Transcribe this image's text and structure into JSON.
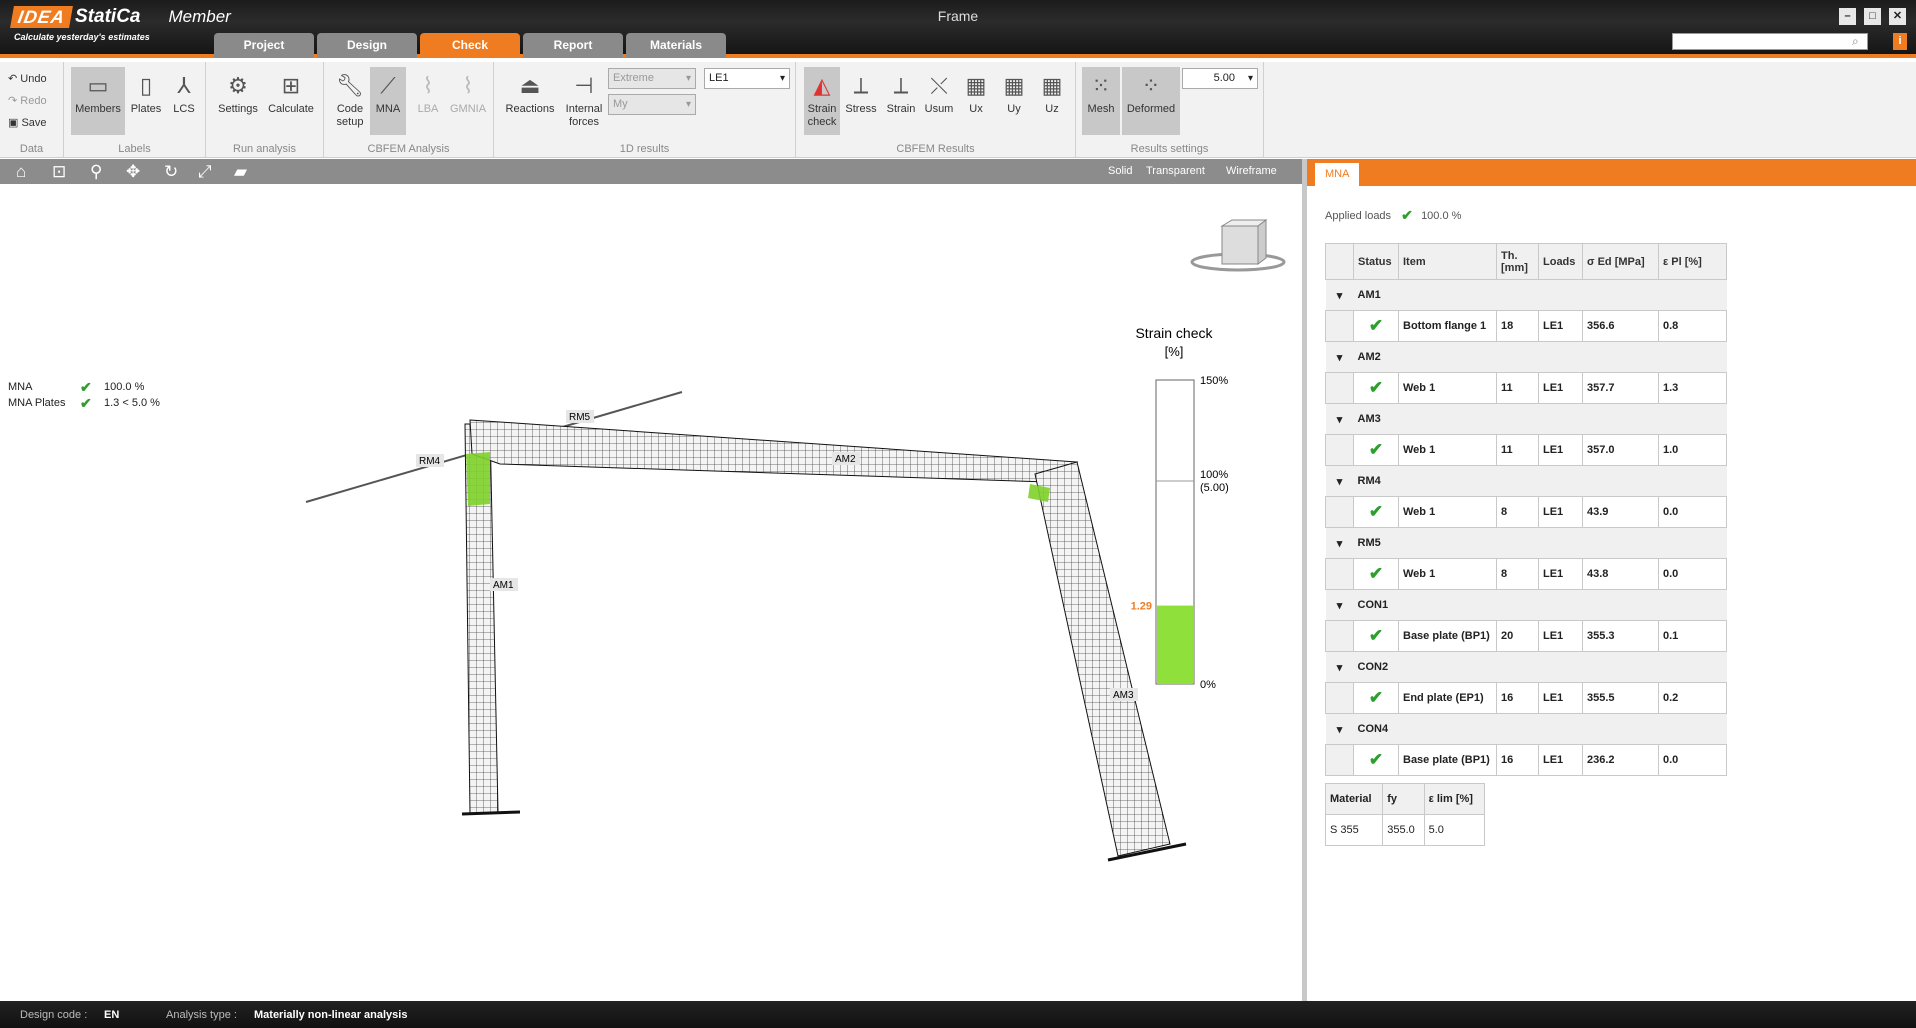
{
  "app": {
    "brand_box": "IDEA",
    "brand_name": "StatiCa",
    "product": "Member",
    "tagline": "Calculate yesterday's estimates",
    "window_title": "Frame"
  },
  "tabs": [
    {
      "label": "Project"
    },
    {
      "label": "Design"
    },
    {
      "label": "Check"
    },
    {
      "label": "Report"
    },
    {
      "label": "Materials"
    }
  ],
  "ribbon": {
    "data": {
      "undo": "Undo",
      "redo": "Redo",
      "save": "Save",
      "label": "Data"
    },
    "labels": {
      "members": "Members",
      "plates": "Plates",
      "lcs": "LCS",
      "label": "Labels"
    },
    "run": {
      "settings": "Settings",
      "calculate": "Calculate",
      "label": "Run analysis"
    },
    "cbfem": {
      "code_setup": "Code setup",
      "mna": "MNA",
      "lba": "LBA",
      "gmnia": "GMNIA",
      "label": "CBFEM Analysis"
    },
    "results1d": {
      "reactions": "Reactions",
      "internal": "Internal forces",
      "extreme": "Extreme",
      "my": "My",
      "le": "LE1",
      "label": "1D results"
    },
    "cbfem_results": {
      "strain_check": "Strain check",
      "stress": "Stress",
      "strain": "Strain",
      "usum": "Usum",
      "ux": "Ux",
      "uy": "Uy",
      "uz": "Uz",
      "label": "CBFEM Results"
    },
    "res_settings": {
      "mesh": "Mesh",
      "deformed": "Deformed",
      "value": "5.00",
      "label": "Results settings"
    }
  },
  "view": {
    "modes": [
      "Solid",
      "Transparent",
      "Wireframe"
    ]
  },
  "status_rows": [
    {
      "label": "MNA",
      "value": "100.0 %"
    },
    {
      "label": "MNA Plates",
      "value": "1.3 < 5.0 %"
    }
  ],
  "legend": {
    "title": "Strain check",
    "unit": "[%]",
    "top": "150%",
    "mid": "100%",
    "mid_sub": "(5.00)",
    "bottom": "0%",
    "current": "1.29",
    "current_fraction": 0.258,
    "color": "#8fe03a"
  },
  "labels3d": [
    "RM5",
    "RM4",
    "AM2",
    "AM1",
    "AM3"
  ],
  "panel": {
    "tab": "MNA",
    "applied_label": "Applied loads",
    "applied_value": "100.0 %",
    "headers": [
      "Status",
      "Item",
      "Th. [mm]",
      "Loads",
      "σ Ed [MPa]",
      "ε Pl [%]"
    ],
    "groups": [
      {
        "name": "AM1",
        "item": "Bottom flange 1",
        "th": "18",
        "loads": "LE1",
        "sigma": "356.6",
        "eps": "0.8"
      },
      {
        "name": "AM2",
        "item": "Web 1",
        "th": "11",
        "loads": "LE1",
        "sigma": "357.7",
        "eps": "1.3"
      },
      {
        "name": "AM3",
        "item": "Web 1",
        "th": "11",
        "loads": "LE1",
        "sigma": "357.0",
        "eps": "1.0"
      },
      {
        "name": "RM4",
        "item": "Web 1",
        "th": "8",
        "loads": "LE1",
        "sigma": "43.9",
        "eps": "0.0"
      },
      {
        "name": "RM5",
        "item": "Web 1",
        "th": "8",
        "loads": "LE1",
        "sigma": "43.8",
        "eps": "0.0"
      },
      {
        "name": "CON1",
        "item": "Base plate (BP1)",
        "th": "20",
        "loads": "LE1",
        "sigma": "355.3",
        "eps": "0.1"
      },
      {
        "name": "CON2",
        "item": "End plate (EP1)",
        "th": "16",
        "loads": "LE1",
        "sigma": "355.5",
        "eps": "0.2"
      },
      {
        "name": "CON4",
        "item": "Base plate (BP1)",
        "th": "16",
        "loads": "LE1",
        "sigma": "236.2",
        "eps": "0.0"
      }
    ],
    "material_headers": [
      "Material",
      "fy",
      "ε lim [%]"
    ],
    "material_row": [
      "S 355",
      "355.0",
      "5.0"
    ]
  },
  "statusbar": {
    "design_code_label": "Design code :",
    "design_code": "EN",
    "analysis_label": "Analysis type :",
    "analysis": "Materially non-linear analysis"
  },
  "colors": {
    "accent": "#f07c21",
    "ok": "#2f9e2f"
  }
}
